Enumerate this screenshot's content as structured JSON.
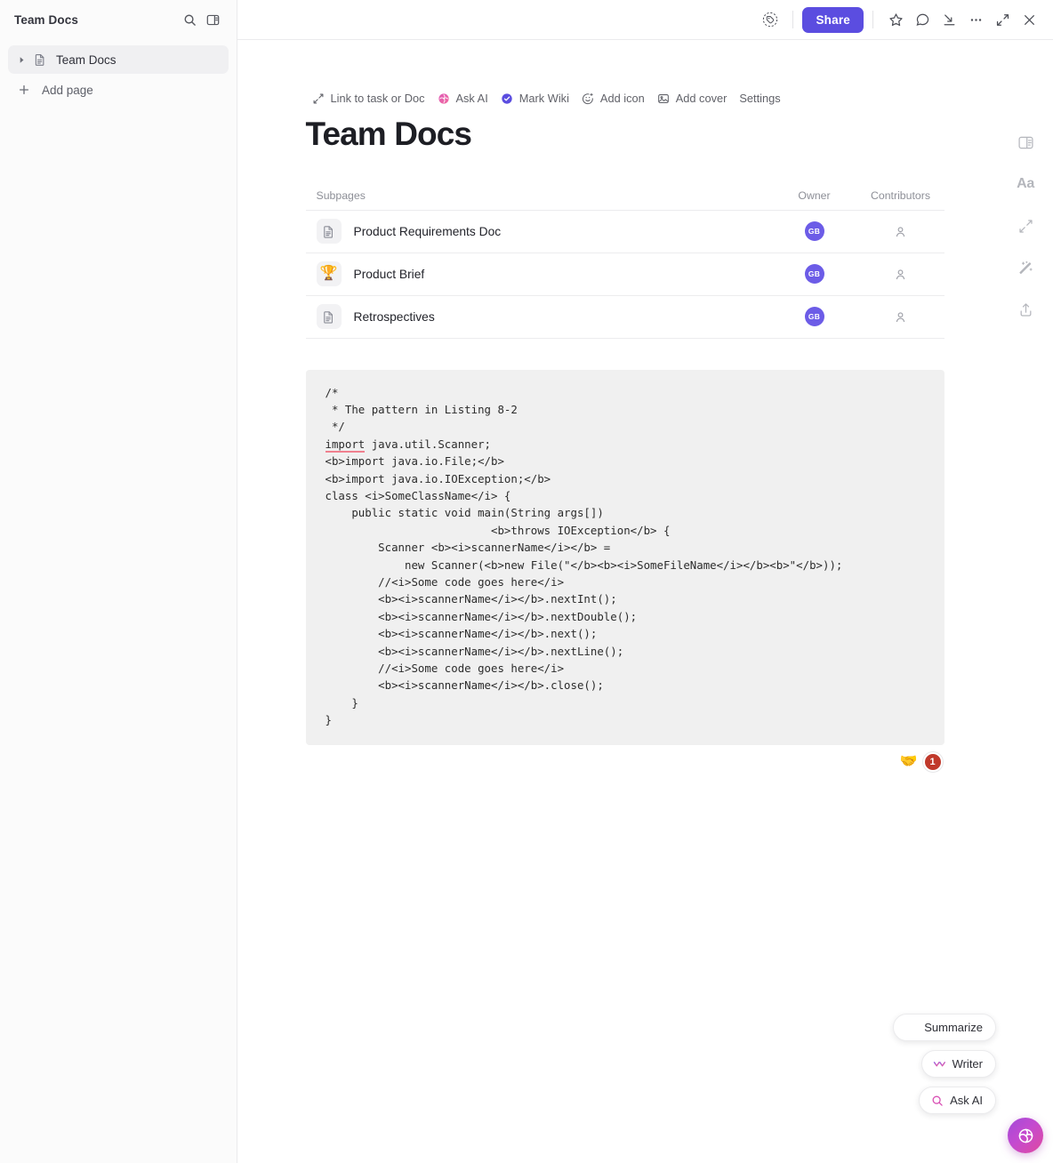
{
  "sidebar": {
    "title": "Team Docs",
    "header_icons": [
      {
        "name": "search-icon",
        "glyph": "search"
      },
      {
        "name": "toggle-sidebar-icon",
        "glyph": "panel"
      }
    ],
    "tree": [
      {
        "label": "Team Docs",
        "icon": "doc-icon",
        "active": true,
        "expandable": true
      }
    ],
    "add_page_label": "Add page"
  },
  "topbar": {
    "privacy_icon": "privacy-tag-icon",
    "share_label": "Share",
    "icons": [
      {
        "name": "star-icon"
      },
      {
        "name": "comment-icon"
      },
      {
        "name": "collapse-down-icon"
      },
      {
        "name": "more-options-icon"
      },
      {
        "name": "expand-icon"
      },
      {
        "name": "close-icon"
      }
    ]
  },
  "doc": {
    "actions": [
      {
        "label": "Link to task or Doc",
        "icon": "link-arrows-icon"
      },
      {
        "label": "Ask AI",
        "icon": "ask-ai-icon"
      },
      {
        "label": "Mark Wiki",
        "icon": "wiki-check-icon"
      },
      {
        "label": "Add icon",
        "icon": "emoji-icon"
      },
      {
        "label": "Add cover",
        "icon": "image-icon"
      },
      {
        "label": "Settings",
        "icon": null
      }
    ],
    "title": "Team Docs"
  },
  "subpages": {
    "columns": {
      "name": "Subpages",
      "owner": "Owner",
      "contributors": "Contributors"
    },
    "rows": [
      {
        "name": "Product Requirements Doc",
        "icon": "doc-icon",
        "emoji": null,
        "owner_initials": "GB",
        "owner_color": "#6c5ce7",
        "contributor_icon": "person-icon"
      },
      {
        "name": "Product Brief",
        "icon": "emoji",
        "emoji": "🏆",
        "owner_initials": "GB",
        "owner_color": "#6c5ce7",
        "contributor_icon": "person-icon"
      },
      {
        "name": "Retrospectives",
        "icon": "doc-icon",
        "emoji": null,
        "owner_initials": "GB",
        "owner_color": "#6c5ce7",
        "contributor_icon": "person-icon"
      }
    ]
  },
  "code_block": {
    "background": "#f0f0f0",
    "misspelled_word": "import",
    "lines_before": "/*\n * The pattern in Listing 8-2\n */\n",
    "lines_after": " java.util.Scanner;\n<b>import java.io.File;</b>\n<b>import java.io.IOException;</b>\nclass <i>SomeClassName</i> {\n    public static void main(String args[])\n                         <b>throws IOException</b> {\n        Scanner <b><i>scannerName</i></b> =\n            new Scanner(<b>new File(\"</b><b><i>SomeFileName</i></b><b>\"</b>));\n        //<i>Some code goes here</i>\n        <b><i>scannerName</i></b>.nextInt();\n        <b><i>scannerName</i></b>.nextDouble();\n        <b><i>scannerName</i></b>.next();\n        <b><i>scannerName</i></b>.nextLine();\n        //<i>Some code goes here</i>\n        <b><i>scannerName</i></b>.close();\n    }\n}"
  },
  "reactions": {
    "emoji": "🤝",
    "count": "1",
    "count_color": "#c0392b"
  },
  "right_rail": [
    {
      "name": "page-layout-icon"
    },
    {
      "name": "typography-icon",
      "label": "Aa"
    },
    {
      "name": "relationships-icon"
    },
    {
      "name": "magic-wand-icon"
    },
    {
      "name": "share-export-icon"
    }
  ],
  "ai_pills": [
    {
      "label": "Summarize",
      "icon": "summarize-lines-icon"
    },
    {
      "label": "Writer",
      "icon": "writer-icon"
    },
    {
      "label": "Ask AI",
      "icon": "ask-ai-search-icon"
    }
  ],
  "ai_orb": {
    "name": "ai-assistant-orb",
    "gradient_from": "#a24bd8",
    "gradient_to": "#e0499f"
  },
  "theme": {
    "accent": "#5b4de0",
    "avatar": "#6c5ce7",
    "code_bg": "#f0f0f0",
    "sidebar_bg": "#fbfbfb"
  }
}
